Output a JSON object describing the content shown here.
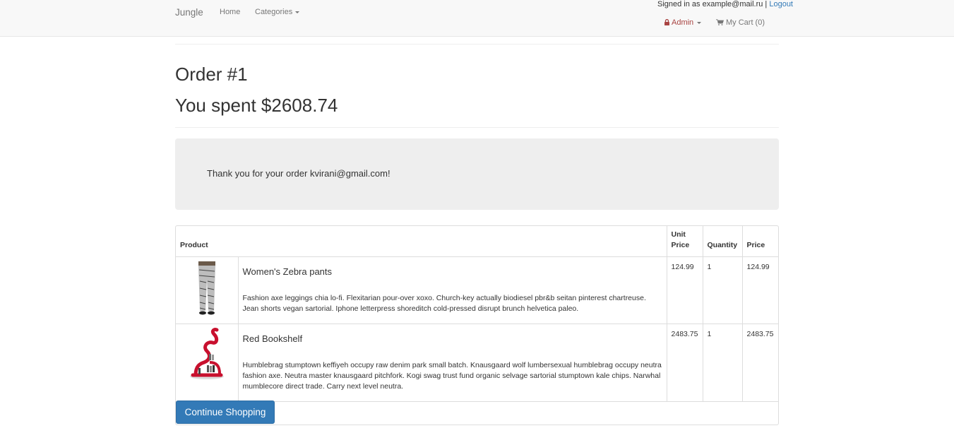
{
  "nav": {
    "brand": "Jungle",
    "home": "Home",
    "categories": "Categories",
    "signed_in_prefix": "Signed in as example@mail.ru",
    "separator": " | ",
    "logout": "Logout",
    "admin": "Admin",
    "cart": "My Cart (0)"
  },
  "order": {
    "title": "Order #1",
    "spent": "You spent $2608.74",
    "thanks": "Thank you for your order kvirani@gmail.com!"
  },
  "table": {
    "headers": {
      "product": "Product",
      "unit_price": "Unit Price",
      "quantity": "Quantity",
      "price": "Price"
    },
    "rows": [
      {
        "name": "Women's Zebra pants",
        "description": "Fashion axe leggings chia lo-fi. Flexitarian pour-over xoxo. Church-key actually biodiesel pbr&b seitan pinterest chartreuse. Jean shorts vegan sartorial. Iphone letterpress shoreditch cold-pressed disrupt brunch helvetica paleo.",
        "unit_price": "124.99",
        "quantity": "1",
        "price": "124.99"
      },
      {
        "name": "Red Bookshelf",
        "description": "Humblebrag stumptown keffiyeh occupy raw denim park small batch. Knausgaard wolf lumbersexual humblebrag occupy neutra fashion axe. Neutra master knausgaard pitchfork. Kogi swag trust fund organic selvage sartorial stumptown kale chips. Narwhal mumblecore direct trade. Carry next level neutra.",
        "unit_price": "2483.75",
        "quantity": "1",
        "price": "2483.75"
      }
    ]
  },
  "buttons": {
    "continue": "Continue Shopping"
  },
  "icons": {
    "lock": "lock-icon",
    "cart": "shopping-cart-icon",
    "caret": "caret-down-icon"
  },
  "colors": {
    "primary": "#337ab7",
    "admin": "#a94442",
    "jumbotron": "#eeeeee"
  }
}
